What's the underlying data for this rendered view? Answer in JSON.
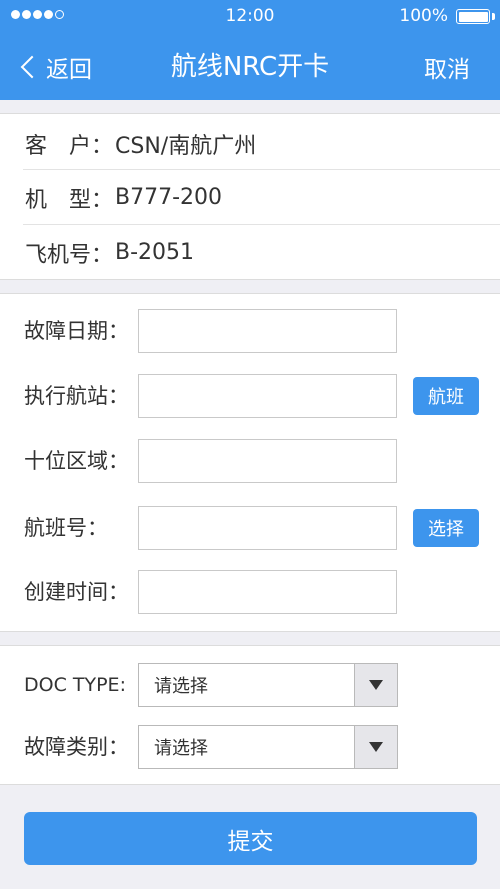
{
  "status_bar": {
    "time": "12:00",
    "battery": "100%"
  },
  "nav": {
    "back_label": "返回",
    "title": "航线NRC开卡",
    "cancel_label": "取消"
  },
  "info": {
    "customer": {
      "label": "客　户：",
      "value": "CSN/南航广州"
    },
    "model": {
      "label": "机　型：",
      "value": "B777-200"
    },
    "aircraft_no": {
      "label": "飞机号：",
      "value": "B-2051"
    }
  },
  "form": {
    "fault_date": {
      "label": "故障日期：",
      "value": ""
    },
    "station": {
      "label": "执行航站：",
      "value": "",
      "button": "航班"
    },
    "zone": {
      "label": "十位区域：",
      "value": ""
    },
    "flight_no": {
      "label": "航班号：",
      "value": "",
      "button": "选择"
    },
    "created_time": {
      "label": "创建时间：",
      "value": ""
    }
  },
  "selects": {
    "doc_type": {
      "label": "DOC TYPE:",
      "value": "请选择"
    },
    "fault_category": {
      "label": "故障类别：",
      "value": "请选择"
    }
  },
  "submit_label": "提交",
  "colors": {
    "primary": "#3d95ed",
    "background": "#efeff4"
  }
}
